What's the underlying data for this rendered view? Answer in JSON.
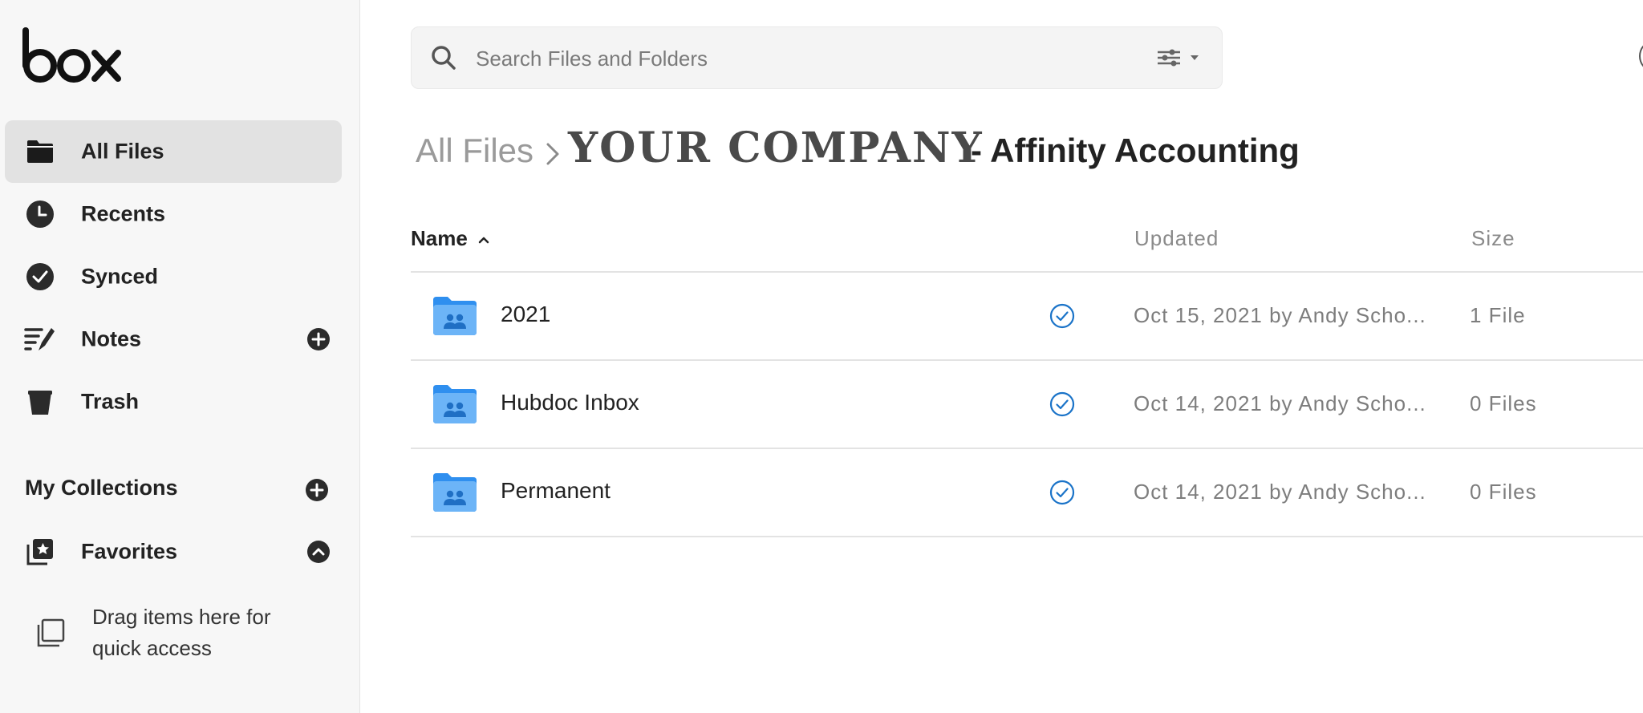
{
  "brand": {
    "logo_text": "box"
  },
  "sidebar": {
    "items": [
      {
        "label": "All Files",
        "icon": "folder-icon",
        "active": true
      },
      {
        "label": "Recents",
        "icon": "clock-icon"
      },
      {
        "label": "Synced",
        "icon": "check-circle-icon"
      },
      {
        "label": "Notes",
        "icon": "notes-icon",
        "has_add": true
      },
      {
        "label": "Trash",
        "icon": "trash-icon"
      }
    ],
    "collections_title": "My Collections",
    "favorites_label": "Favorites",
    "drag_hint": "Drag items here for quick access"
  },
  "search": {
    "placeholder": "Search Files and Folders",
    "value": ""
  },
  "breadcrumb": {
    "root": "All Files",
    "company_logo": "YOUR COMPANY",
    "title": "- Affinity Accounting"
  },
  "table": {
    "columns": {
      "name": "Name",
      "updated": "Updated",
      "size": "Size"
    },
    "sort": "name-ascending",
    "rows": [
      {
        "name": "2021",
        "updated": "Oct 15, 2021 by Andy Scho...",
        "size": "1 File",
        "synced": true
      },
      {
        "name": "Hubdoc Inbox",
        "updated": "Oct 14, 2021 by Andy Scho...",
        "size": "0 Files",
        "synced": true
      },
      {
        "name": "Permanent",
        "updated": "Oct 14, 2021 by Andy Scho...",
        "size": "0 Files",
        "synced": true
      }
    ]
  },
  "colors": {
    "folder_blue": "#5aa9f5",
    "sync_blue": "#1a73c8",
    "sidebar_bg": "#f7f7f7",
    "active_bg": "#e2e2e2"
  }
}
